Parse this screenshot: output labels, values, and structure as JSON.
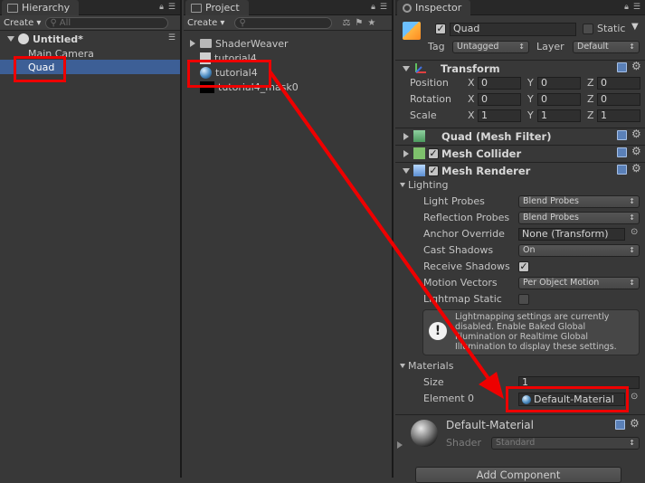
{
  "hierarchy": {
    "tab_label": "Hierarchy",
    "create_label": "Create ▾",
    "search_placeholder": "All",
    "scene_name": "Untitled*",
    "items": [
      {
        "label": "Main Camera"
      },
      {
        "label": "Quad"
      }
    ]
  },
  "project": {
    "tab_label": "Project",
    "create_label": "Create ▾",
    "items": [
      {
        "label": "ShaderWeaver"
      },
      {
        "label": "tutorial4"
      },
      {
        "label": "tutorial4"
      },
      {
        "label": "tutorial4_mask0"
      }
    ]
  },
  "inspector": {
    "tab_label": "Inspector",
    "object_name": "Quad",
    "static_label": "Static",
    "tag_label": "Tag",
    "tag_value": "Untagged",
    "layer_label": "Layer",
    "layer_value": "Default",
    "transform": {
      "title": "Transform",
      "rows": [
        {
          "label": "Position",
          "x": "0",
          "y": "0",
          "z": "0"
        },
        {
          "label": "Rotation",
          "x": "0",
          "y": "0",
          "z": "0"
        },
        {
          "label": "Scale",
          "x": "1",
          "y": "1",
          "z": "1"
        }
      ],
      "axis_x": "X",
      "axis_y": "Y",
      "axis_z": "Z"
    },
    "mesh_filter_title": "Quad (Mesh Filter)",
    "mesh_collider_title": "Mesh Collider",
    "mesh_renderer_title": "Mesh Renderer",
    "lighting": {
      "title": "Lighting",
      "light_probes_label": "Light Probes",
      "light_probes_value": "Blend Probes",
      "reflection_probes_label": "Reflection Probes",
      "reflection_probes_value": "Blend Probes",
      "anchor_override_label": "Anchor Override",
      "anchor_override_value": "None (Transform)",
      "cast_shadows_label": "Cast Shadows",
      "cast_shadows_value": "On",
      "receive_shadows_label": "Receive Shadows",
      "motion_vectors_label": "Motion Vectors",
      "motion_vectors_value": "Per Object Motion",
      "lightmap_static_label": "Lightmap Static"
    },
    "info_message": "Lightmapping settings are currently disabled. Enable Baked Global Illumination or Realtime Global Illumination to display these settings.",
    "materials": {
      "title": "Materials",
      "size_label": "Size",
      "size_value": "1",
      "element0_label": "Element 0",
      "element0_value": "Default-Material"
    },
    "material_preview": {
      "name": "Default-Material",
      "shader_label": "Shader",
      "shader_value": "Standard"
    },
    "add_component_label": "Add Component"
  },
  "colors": {
    "highlight": "#3d5f96",
    "annotation": "#ee0000",
    "panel_bg": "#383838"
  }
}
